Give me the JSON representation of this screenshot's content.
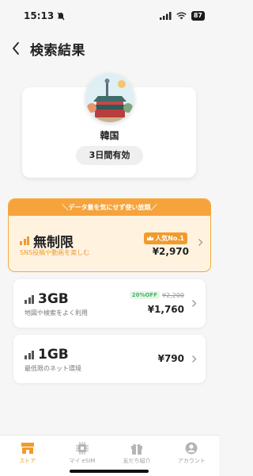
{
  "status_bar": {
    "time": "15:13",
    "battery": "87"
  },
  "header": {
    "title": "検索結果"
  },
  "country": {
    "name": "韓国",
    "validity": "3日間有効"
  },
  "plans": [
    {
      "banner": "＼データ量を気にせず使い放題／",
      "name": "無制限",
      "description": "SNS投稿や動画を楽しむ",
      "badge": "人気No.1",
      "price": "¥2,970",
      "signal_color": "#f19b2c"
    },
    {
      "name": "3GB",
      "description": "地図や検索をよく利用",
      "discount_badge": "20%OFF",
      "original_price": "¥2,200",
      "price": "¥1,760",
      "signal_color": "#555555"
    },
    {
      "name": "1GB",
      "description": "最低限のネット環境",
      "price": "¥790",
      "signal_color": "#555555"
    }
  ],
  "tab_bar": {
    "tabs": [
      {
        "label": "ストア",
        "icon": "store-icon",
        "active": true
      },
      {
        "label": "マイ eSIM",
        "icon": "chip-icon",
        "active": false
      },
      {
        "label": "友だち紹介",
        "icon": "gift-icon",
        "active": false
      },
      {
        "label": "アカウント",
        "icon": "account-icon",
        "active": false
      }
    ]
  },
  "colors": {
    "accent": "#f19b2c",
    "banner": "#f6a33b",
    "highlight_bg": "#fff3e0",
    "discount": "#4caf6a"
  }
}
